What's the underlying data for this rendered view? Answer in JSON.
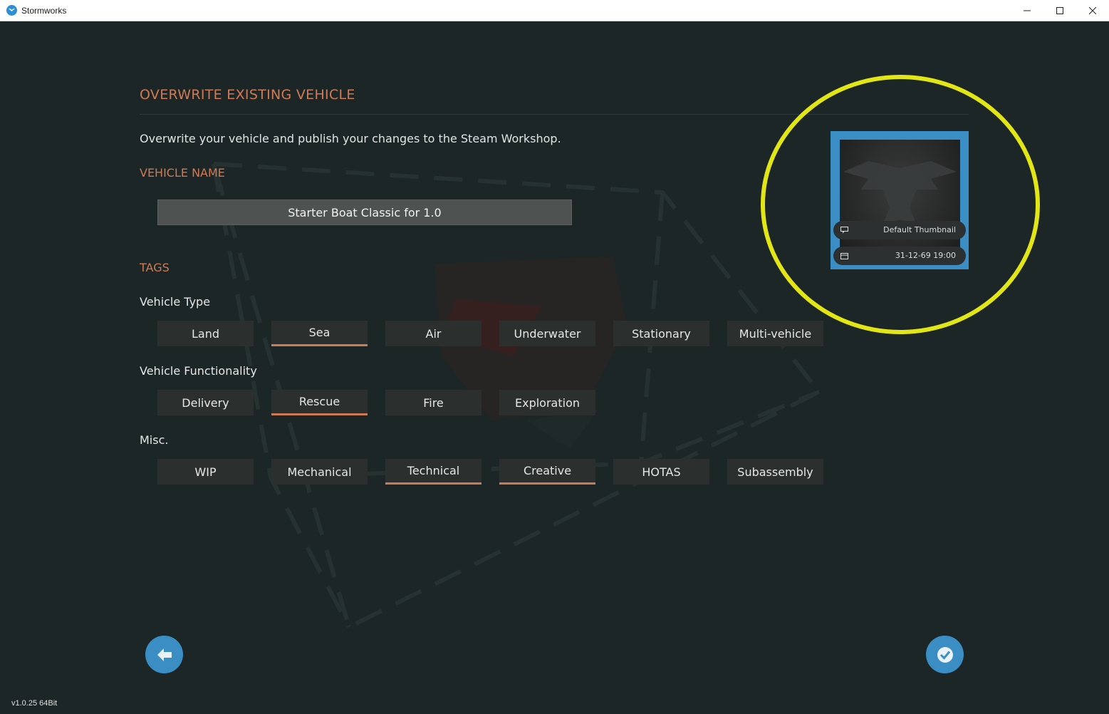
{
  "window": {
    "title": "Stormworks"
  },
  "dialog": {
    "heading": "OVERWRITE EXISTING VEHICLE",
    "description": "Overwrite your vehicle and publish your changes to the Steam Workshop.",
    "vehicle_name_label": "VEHICLE NAME",
    "vehicle_name_value": "Starter Boat Classic for 1.0",
    "tags_label": "TAGS",
    "groups": {
      "vehicle_type": {
        "label": "Vehicle Type",
        "tags": [
          {
            "label": "Land",
            "selected": false
          },
          {
            "label": "Sea",
            "selected": true
          },
          {
            "label": "Air",
            "selected": false
          },
          {
            "label": "Underwater",
            "selected": false
          },
          {
            "label": "Stationary",
            "selected": false
          },
          {
            "label": "Multi-vehicle",
            "selected": false
          }
        ]
      },
      "vehicle_functionality": {
        "label": "Vehicle Functionality",
        "tags": [
          {
            "label": "Delivery",
            "selected": false
          },
          {
            "label": "Rescue",
            "selected": true
          },
          {
            "label": "Fire",
            "selected": false
          },
          {
            "label": "Exploration",
            "selected": false
          }
        ]
      },
      "misc": {
        "label": "Misc.",
        "tags": [
          {
            "label": "WIP",
            "selected": false
          },
          {
            "label": "Mechanical",
            "selected": false
          },
          {
            "label": "Technical",
            "selected": true
          },
          {
            "label": "Creative",
            "selected": true
          },
          {
            "label": "HOTAS",
            "selected": false
          },
          {
            "label": "Subassembly",
            "selected": false
          }
        ]
      }
    }
  },
  "thumbnail": {
    "name": "Default Thumbnail",
    "date": "31-12-69 19:00"
  },
  "footer": {
    "version": "v1.0.25 64Bit"
  },
  "colors": {
    "accent": "#d07a55",
    "button_blue": "#3b8ec4",
    "highlight_ring": "#e2e614",
    "background": "#1c2626"
  },
  "icons": {
    "back": "arrow-left-icon",
    "confirm": "checkmark-icon",
    "thumbnail_name": "speech-bubble-icon",
    "thumbnail_date": "calendar-icon"
  }
}
